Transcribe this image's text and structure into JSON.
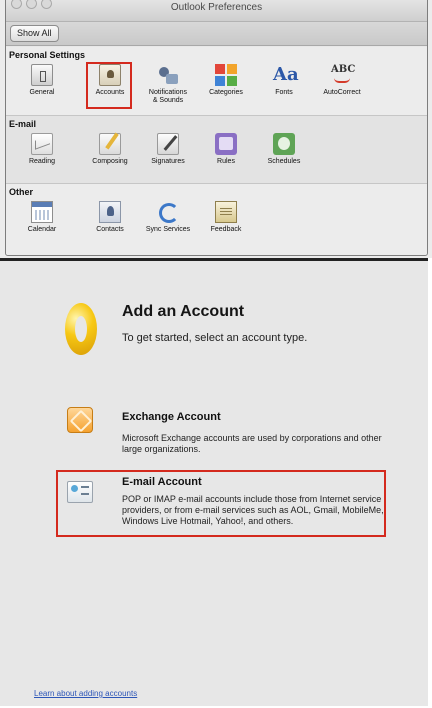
{
  "window": {
    "title": "Outlook Preferences"
  },
  "toolbar": {
    "show_all_label": "Show All"
  },
  "sections": {
    "personal": {
      "title": "Personal Settings",
      "items": [
        {
          "label": "General",
          "icon": "general-icon"
        },
        {
          "label": "Accounts",
          "icon": "accounts-icon",
          "highlighted": true
        },
        {
          "label": "Notifications\n& Sounds",
          "icon": "notifications-icon"
        },
        {
          "label": "Categories",
          "icon": "categories-icon"
        },
        {
          "label": "Fonts",
          "icon": "fonts-icon"
        },
        {
          "label": "AutoCorrect",
          "icon": "autocorrect-icon"
        }
      ]
    },
    "email": {
      "title": "E-mail",
      "items": [
        {
          "label": "Reading",
          "icon": "reading-icon"
        },
        {
          "label": "Composing",
          "icon": "composing-icon"
        },
        {
          "label": "Signatures",
          "icon": "signatures-icon"
        },
        {
          "label": "Rules",
          "icon": "rules-icon"
        },
        {
          "label": "Schedules",
          "icon": "schedules-icon"
        }
      ]
    },
    "other": {
      "title": "Other",
      "items": [
        {
          "label": "Calendar",
          "icon": "calendar-icon"
        },
        {
          "label": "Contacts",
          "icon": "contacts-icon"
        },
        {
          "label": "Sync Services",
          "icon": "sync-icon"
        },
        {
          "label": "Feedback",
          "icon": "feedback-icon"
        }
      ]
    }
  },
  "add_account": {
    "title": "Add an Account",
    "subtitle": "To get started, select an account type.",
    "exchange": {
      "title": "Exchange Account",
      "description": "Microsoft Exchange accounts are used by corporations and other large organizations.",
      "icon": "exchange-icon"
    },
    "email": {
      "title": "E-mail Account",
      "description": "POP or IMAP e-mail accounts include those from Internet service providers, or from e-mail services such as AOL, Gmail, MobileMe, Windows Live Hotmail, Yahoo!, and others.",
      "icon": "email-account-icon",
      "highlighted": true
    },
    "learn_link": "Learn about adding accounts"
  },
  "colors": {
    "highlight": "#d42a1e",
    "link": "#2d56b8",
    "logo": "#f7c814"
  }
}
